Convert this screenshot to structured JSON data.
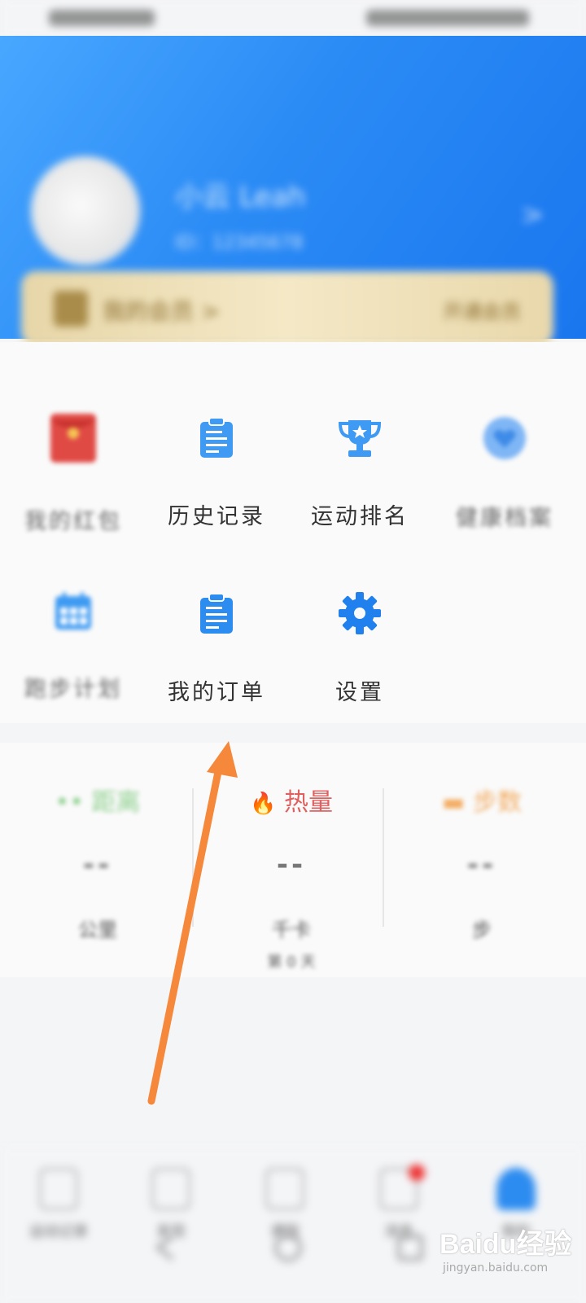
{
  "status_bar": {
    "left": "",
    "right": ""
  },
  "profile": {
    "username": "小云 Leah",
    "id_label": "ID：12345678",
    "chevron": ">"
  },
  "vip_banner": {
    "label": "我的会员 >",
    "action": "开通会员"
  },
  "menu": {
    "items": [
      {
        "label": "我的红包",
        "icon": "red-envelope-icon"
      },
      {
        "label": "历史记录",
        "icon": "clipboard-icon"
      },
      {
        "label": "运动排名",
        "icon": "trophy-icon"
      },
      {
        "label": "健康档案",
        "icon": "heart-badge-icon"
      },
      {
        "label": "跑步计划",
        "icon": "calendar-icon"
      },
      {
        "label": "我的订单",
        "icon": "clipboard-icon"
      },
      {
        "label": "设置",
        "icon": "gear-icon"
      }
    ]
  },
  "stats": [
    {
      "title": "距离",
      "value": "--",
      "unit": "公里",
      "color": "#7ac77a",
      "icon": "route-icon"
    },
    {
      "title": "热量",
      "value": "--",
      "unit": "千卡",
      "note": "第 0 天",
      "color": "#e05a5a",
      "icon": "flame-icon"
    },
    {
      "title": "步数",
      "value": "--",
      "unit": "步",
      "color": "#f0a04a",
      "icon": "shoe-icon"
    }
  ],
  "tabbar": {
    "items": [
      {
        "label": "运动记录",
        "icon": "watch-icon"
      },
      {
        "label": "发现",
        "icon": "compass-icon"
      },
      {
        "label": "课程",
        "icon": "book-icon"
      },
      {
        "label": "消息",
        "icon": "message-icon"
      },
      {
        "label": "我的",
        "icon": "person-icon"
      }
    ],
    "active_index": 4
  },
  "watermark": {
    "logo": "Baidu经验",
    "sub": "jingyan.baidu.com"
  },
  "colors": {
    "header": "#2b8bf5",
    "accent": "#2d8cf0",
    "arrow": "#f5883a"
  }
}
